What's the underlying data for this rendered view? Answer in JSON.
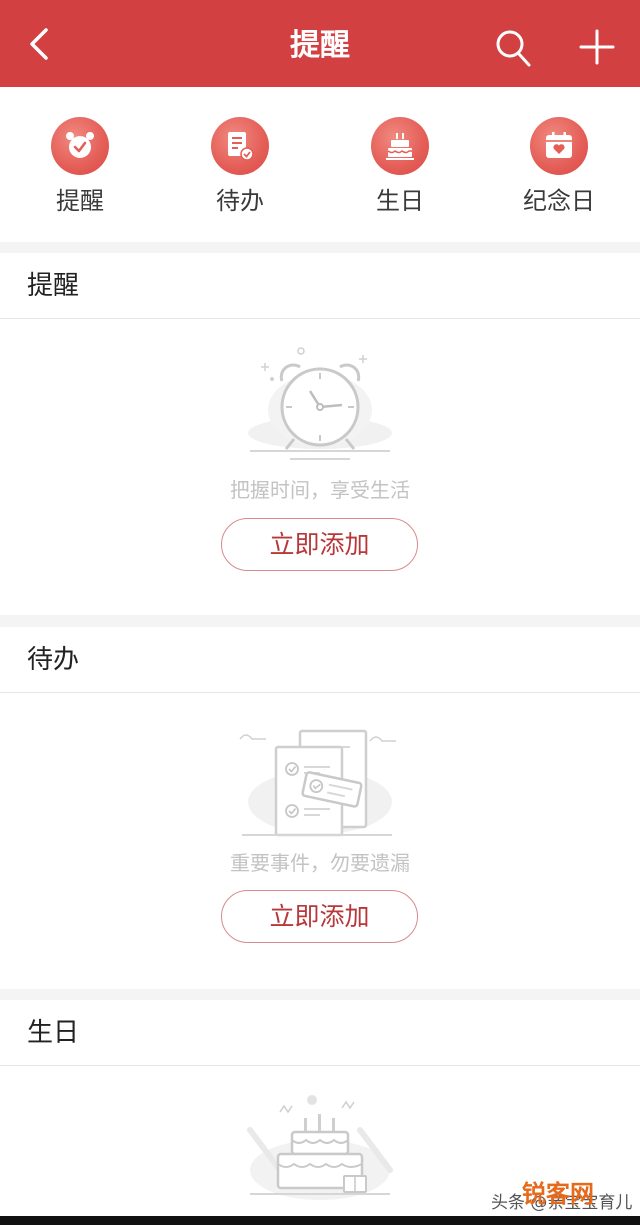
{
  "header": {
    "title": "提醒",
    "back_icon": "chevron-left-icon",
    "search_icon": "search-icon",
    "add_icon": "plus-icon",
    "color": "#d34041"
  },
  "categories": [
    {
      "label": "提醒",
      "icon": "alarm-clock-icon"
    },
    {
      "label": "待办",
      "icon": "todo-list-icon"
    },
    {
      "label": "生日",
      "icon": "birthday-cake-icon"
    },
    {
      "label": "纪念日",
      "icon": "calendar-heart-icon"
    }
  ],
  "sections": [
    {
      "title": "提醒",
      "hint": "把握时间，享受生活",
      "button": "立即添加",
      "illustration": "alarm-clock-illustration"
    },
    {
      "title": "待办",
      "hint": "重要事件，勿要遗漏",
      "button": "立即添加",
      "illustration": "todo-documents-illustration"
    },
    {
      "title": "生日",
      "illustration": "birthday-cake-illustration"
    }
  ],
  "watermark": {
    "source": "头条 @亲宝宝育儿",
    "logo": "锐客网"
  }
}
